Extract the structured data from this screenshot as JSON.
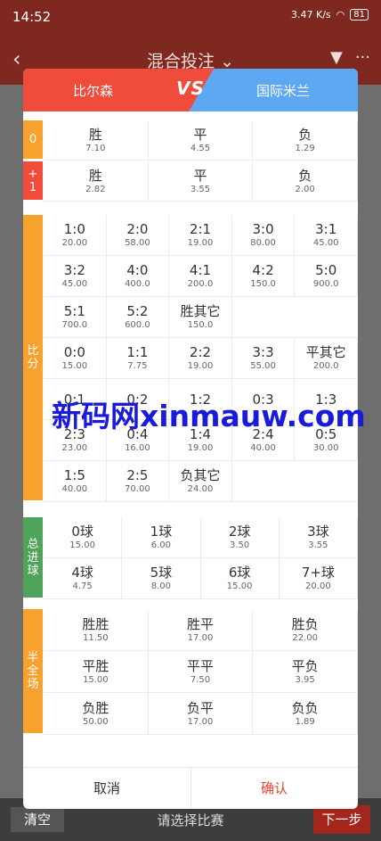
{
  "status": {
    "time": "14:52",
    "net_speed": "3.47 K/s",
    "battery": "81"
  },
  "topbar": {
    "title": "混合投注"
  },
  "bottombar": {
    "clear": "清空",
    "prompt": "请选择比赛",
    "next": "下一步"
  },
  "match": {
    "home": "比尔森",
    "vs": "VS",
    "away": "国际米兰"
  },
  "sections": [
    {
      "label": "0",
      "color": "#f7a12f",
      "cols": 3,
      "cells": [
        {
          "n": "胜",
          "v": "7.10"
        },
        {
          "n": "平",
          "v": "4.55"
        },
        {
          "n": "负",
          "v": "1.29"
        }
      ]
    },
    {
      "label": "+1",
      "color": "#f04b3b",
      "cols": 3,
      "cells": [
        {
          "n": "胜",
          "v": "2.82"
        },
        {
          "n": "平",
          "v": "3.55"
        },
        {
          "n": "负",
          "v": "2.00"
        }
      ]
    },
    {
      "label": "比分",
      "color": "#f7a12f",
      "cols": 5,
      "cells": [
        {
          "n": "1:0",
          "v": "20.00"
        },
        {
          "n": "2:0",
          "v": "58.00"
        },
        {
          "n": "2:1",
          "v": "19.00"
        },
        {
          "n": "3:0",
          "v": "80.00"
        },
        {
          "n": "3:1",
          "v": "45.00"
        },
        {
          "n": "3:2",
          "v": "45.00"
        },
        {
          "n": "4:0",
          "v": "400.0"
        },
        {
          "n": "4:1",
          "v": "200.0"
        },
        {
          "n": "4:2",
          "v": "150.0"
        },
        {
          "n": "5:0",
          "v": "900.0"
        },
        {
          "n": "5:1",
          "v": "700.0"
        },
        {
          "n": "5:2",
          "v": "600.0"
        },
        {
          "n": "胜其它",
          "v": "150.0"
        },
        {
          "n": "",
          "v": ""
        },
        {
          "n": "",
          "v": ""
        },
        {
          "n": "0:0",
          "v": "15.00"
        },
        {
          "n": "1:1",
          "v": "7.75"
        },
        {
          "n": "2:2",
          "v": "19.00"
        },
        {
          "n": "3:3",
          "v": "55.00"
        },
        {
          "n": "平其它",
          "v": "200.0"
        },
        {
          "n": "0:1",
          "v": ""
        },
        {
          "n": "0:2",
          "v": ""
        },
        {
          "n": "1:2",
          "v": ""
        },
        {
          "n": "0:3",
          "v": ""
        },
        {
          "n": "1:3",
          "v": ""
        },
        {
          "n": "2:3",
          "v": "23.00"
        },
        {
          "n": "0:4",
          "v": "16.00"
        },
        {
          "n": "1:4",
          "v": "19.00"
        },
        {
          "n": "2:4",
          "v": "40.00"
        },
        {
          "n": "0:5",
          "v": "30.00"
        },
        {
          "n": "1:5",
          "v": "40.00"
        },
        {
          "n": "2:5",
          "v": "70.00"
        },
        {
          "n": "负其它",
          "v": "24.00"
        },
        {
          "n": "",
          "v": ""
        },
        {
          "n": "",
          "v": ""
        }
      ]
    },
    {
      "label": "总进球",
      "color": "#4fa35a",
      "cols": 4,
      "cells": [
        {
          "n": "0球",
          "v": "15.00"
        },
        {
          "n": "1球",
          "v": "6.00"
        },
        {
          "n": "2球",
          "v": "3.50"
        },
        {
          "n": "3球",
          "v": "3.55"
        },
        {
          "n": "4球",
          "v": "4.75"
        },
        {
          "n": "5球",
          "v": "8.00"
        },
        {
          "n": "6球",
          "v": "15.00"
        },
        {
          "n": "7+球",
          "v": "20.00"
        }
      ]
    },
    {
      "label": "半全场",
      "color": "#f7a12f",
      "cols": 3,
      "cells": [
        {
          "n": "胜胜",
          "v": "11.50"
        },
        {
          "n": "胜平",
          "v": "17.00"
        },
        {
          "n": "胜负",
          "v": "22.00"
        },
        {
          "n": "平胜",
          "v": "15.00"
        },
        {
          "n": "平平",
          "v": "7.50"
        },
        {
          "n": "平负",
          "v": "3.95"
        },
        {
          "n": "负胜",
          "v": "50.00"
        },
        {
          "n": "负平",
          "v": "17.00"
        },
        {
          "n": "负负",
          "v": "1.89"
        }
      ]
    }
  ],
  "footer": {
    "cancel": "取消",
    "confirm": "确认"
  },
  "watermark": "新码网xinmauw.com"
}
